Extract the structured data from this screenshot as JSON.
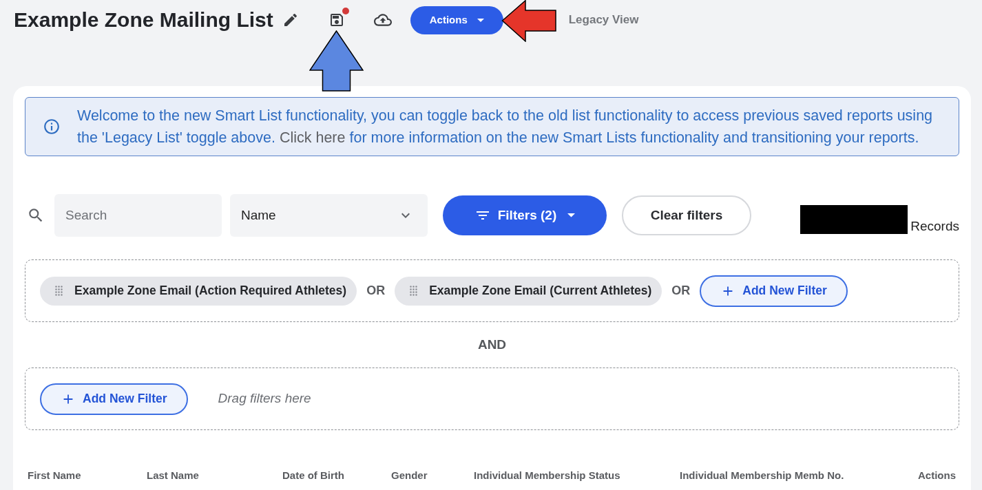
{
  "header": {
    "title": "Example Zone Mailing List",
    "save_unsaved": true,
    "actions_button": "Actions",
    "legacy_view": "Legacy View"
  },
  "info_banner": {
    "text_before": "Welcome to the new Smart List functionality, you can toggle back to the old list functionality to access previous saved reports using the 'Legacy List' toggle above.",
    "link": "Click here",
    "text_after": "for more information on the new Smart Lists functionality and transitioning your reports."
  },
  "toolbar": {
    "search": {
      "placeholder": "Search"
    },
    "field_select": {
      "value": "Name"
    },
    "filters_button": "Filters (2)",
    "clear_filters": "Clear filters",
    "records": {
      "label": "Records",
      "count_redacted": true
    }
  },
  "filter_groups": [
    {
      "items": [
        {
          "kind": "chip",
          "label": "Example Zone Email (Action Required Athletes)"
        },
        {
          "kind": "connector",
          "label": "OR"
        },
        {
          "kind": "chip",
          "label": "Example Zone Email (Current Athletes)"
        },
        {
          "kind": "connector",
          "label": "OR"
        },
        {
          "kind": "add_button",
          "label": "Add New Filter"
        }
      ]
    },
    {
      "items": [
        {
          "kind": "add_button",
          "label": "Add New Filter"
        },
        {
          "kind": "hint",
          "label": "Drag filters here"
        }
      ]
    }
  ],
  "group_joiner": "AND",
  "table": {
    "columns": [
      "First Name",
      "Last Name",
      "Date of Birth",
      "Gender",
      "Individual Membership Status",
      "Individual Membership Memb No.",
      "Actions"
    ]
  },
  "annotations": [
    {
      "kind": "arrow_up",
      "color": "#5b87e0"
    },
    {
      "kind": "arrow_left",
      "color": "#e5352a"
    }
  ]
}
